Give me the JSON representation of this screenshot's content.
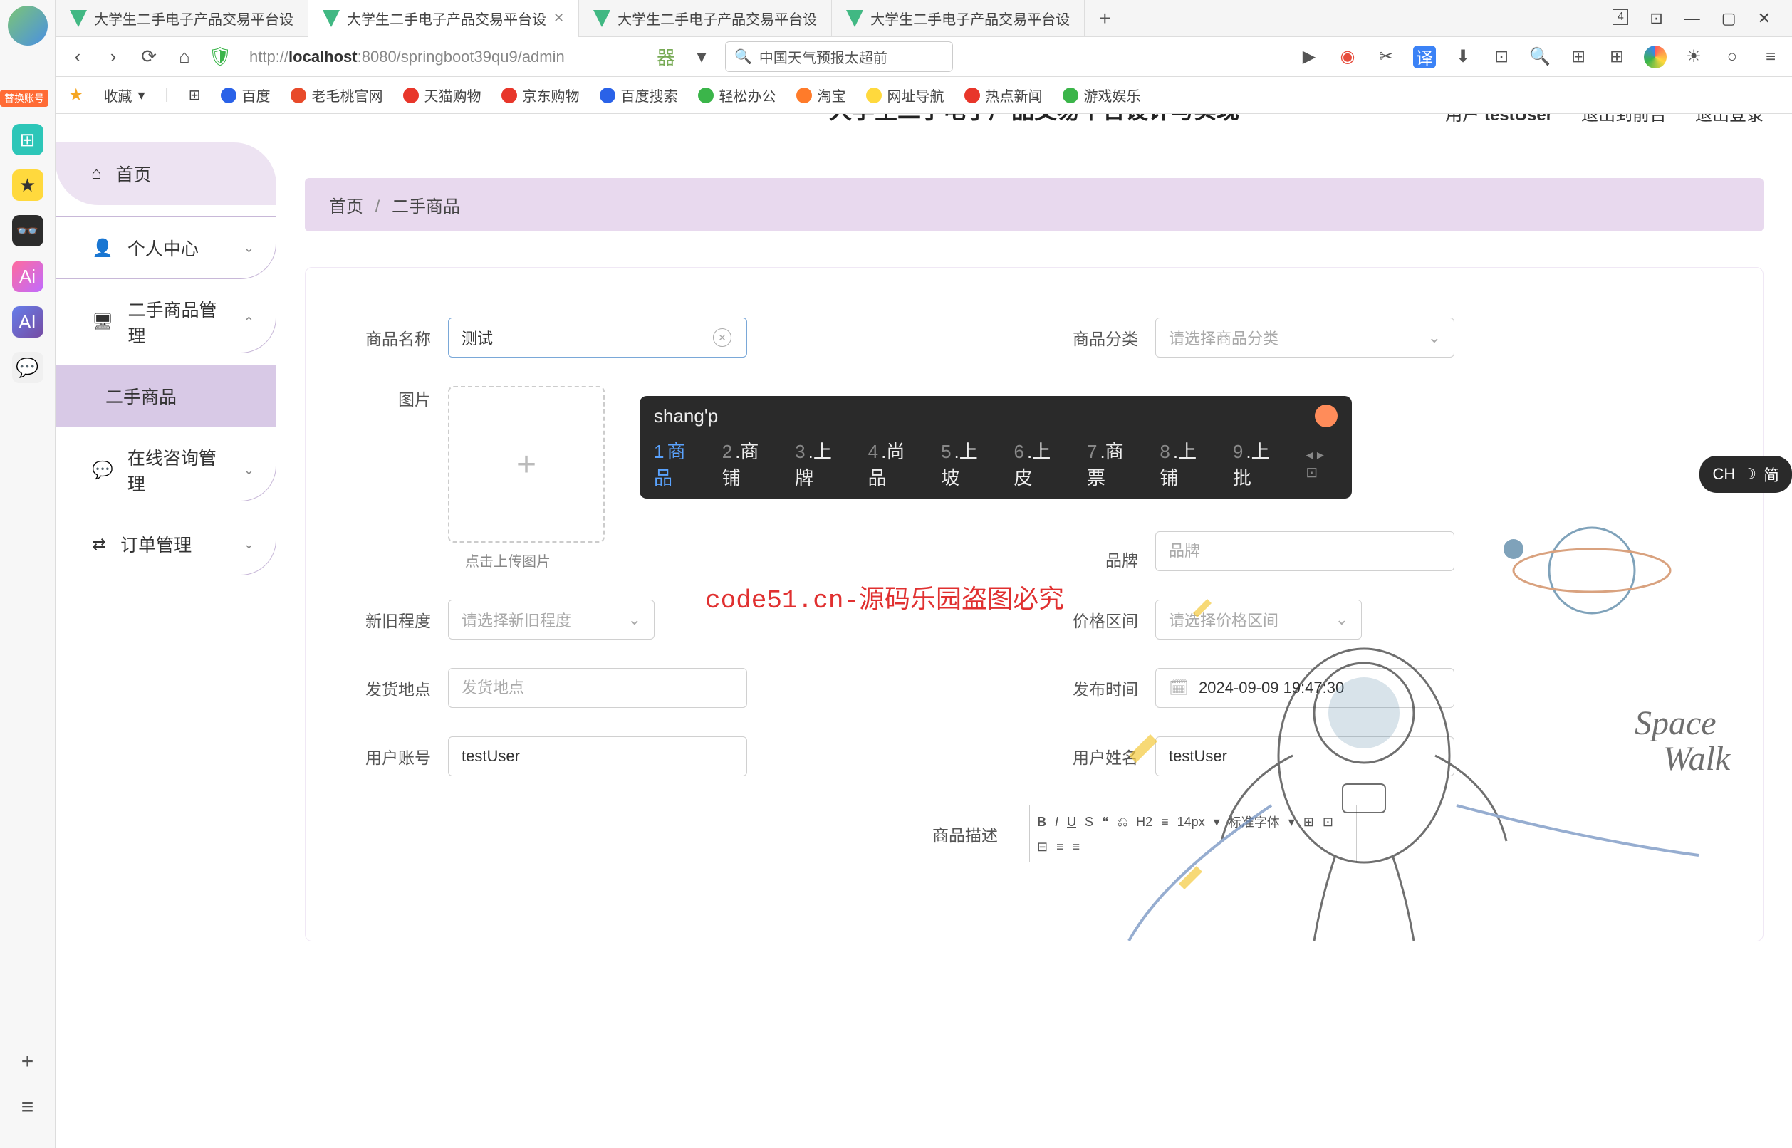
{
  "browser": {
    "tabs": [
      {
        "title": "大学生二手电子产品交易平台设",
        "active": false
      },
      {
        "title": "大学生二手电子产品交易平台设",
        "active": true
      },
      {
        "title": "大学生二手电子产品交易平台设",
        "active": false
      },
      {
        "title": "大学生二手电子产品交易平台设",
        "active": false
      }
    ],
    "tab_count_badge": "4",
    "url_prefix": "http://",
    "url_host": "localhost",
    "url_rest": ":8080/springboot39qu9/admin",
    "search_text": "中国天气预报太超前",
    "bookmarks": {
      "fav_label": "收藏",
      "items": [
        "百度",
        "老毛桃官网",
        "天猫购物",
        "京东购物",
        "百度搜索",
        "轻松办公",
        "淘宝",
        "网址导航",
        "热点新闻",
        "游戏娱乐"
      ]
    },
    "side_badge": "替换账号"
  },
  "app": {
    "title": "大学生二手电子产品交易平台设计与实现",
    "header": {
      "user_prefix": "用户",
      "user_name": "testUser",
      "back_front": "退出到前台",
      "logout": "退出登录"
    },
    "sidebar": {
      "items": [
        {
          "icon": "home",
          "label": "首页",
          "type": "top"
        },
        {
          "icon": "user",
          "label": "个人中心",
          "type": "group",
          "chevron": "down"
        },
        {
          "icon": "monitor",
          "label": "二手商品管理",
          "type": "group",
          "chevron": "up"
        },
        {
          "icon": "",
          "label": "二手商品",
          "type": "sub-active"
        },
        {
          "icon": "chat",
          "label": "在线咨询管理",
          "type": "group",
          "chevron": "down"
        },
        {
          "icon": "list",
          "label": "订单管理",
          "type": "group",
          "chevron": "down"
        }
      ]
    },
    "breadcrumb": {
      "root": "首页",
      "leaf": "二手商品"
    },
    "form": {
      "product_name": {
        "label": "商品名称",
        "value": "测试"
      },
      "category": {
        "label": "商品分类",
        "placeholder": "请选择商品分类"
      },
      "image": {
        "label": "图片",
        "hint": "点击上传图片"
      },
      "brand": {
        "label": "品牌",
        "placeholder": "品牌"
      },
      "condition": {
        "label": "新旧程度",
        "placeholder": "请选择新旧程度"
      },
      "price_range": {
        "label": "价格区间",
        "placeholder": "请选择价格区间"
      },
      "ship_from": {
        "label": "发货地点",
        "placeholder": "发货地点"
      },
      "publish_time": {
        "label": "发布时间",
        "value": "2024-09-09 19:47:30"
      },
      "user_account": {
        "label": "用户账号",
        "value": "testUser"
      },
      "user_name": {
        "label": "用户姓名",
        "value": "testUser"
      },
      "description": {
        "label": "商品描述"
      },
      "editor": {
        "heading": "H2",
        "fontsize": "14px",
        "fontfamily": "标准字体"
      }
    }
  },
  "ime": {
    "input": "shang'p",
    "candidates": [
      {
        "n": "1",
        "t": "商品"
      },
      {
        "n": "2",
        "t": "商铺"
      },
      {
        "n": "3",
        "t": "上牌"
      },
      {
        "n": "4",
        "t": "尚品"
      },
      {
        "n": "5",
        "t": "上坡"
      },
      {
        "n": "6",
        "t": "上皮"
      },
      {
        "n": "7",
        "t": "商票"
      },
      {
        "n": "8",
        "t": "上铺"
      },
      {
        "n": "9",
        "t": "上批"
      }
    ],
    "indicator": {
      "lang": "CH",
      "mode": "简"
    }
  },
  "watermark": {
    "text": "code51.cn",
    "red": "code51.cn-源码乐园盗图必究"
  }
}
